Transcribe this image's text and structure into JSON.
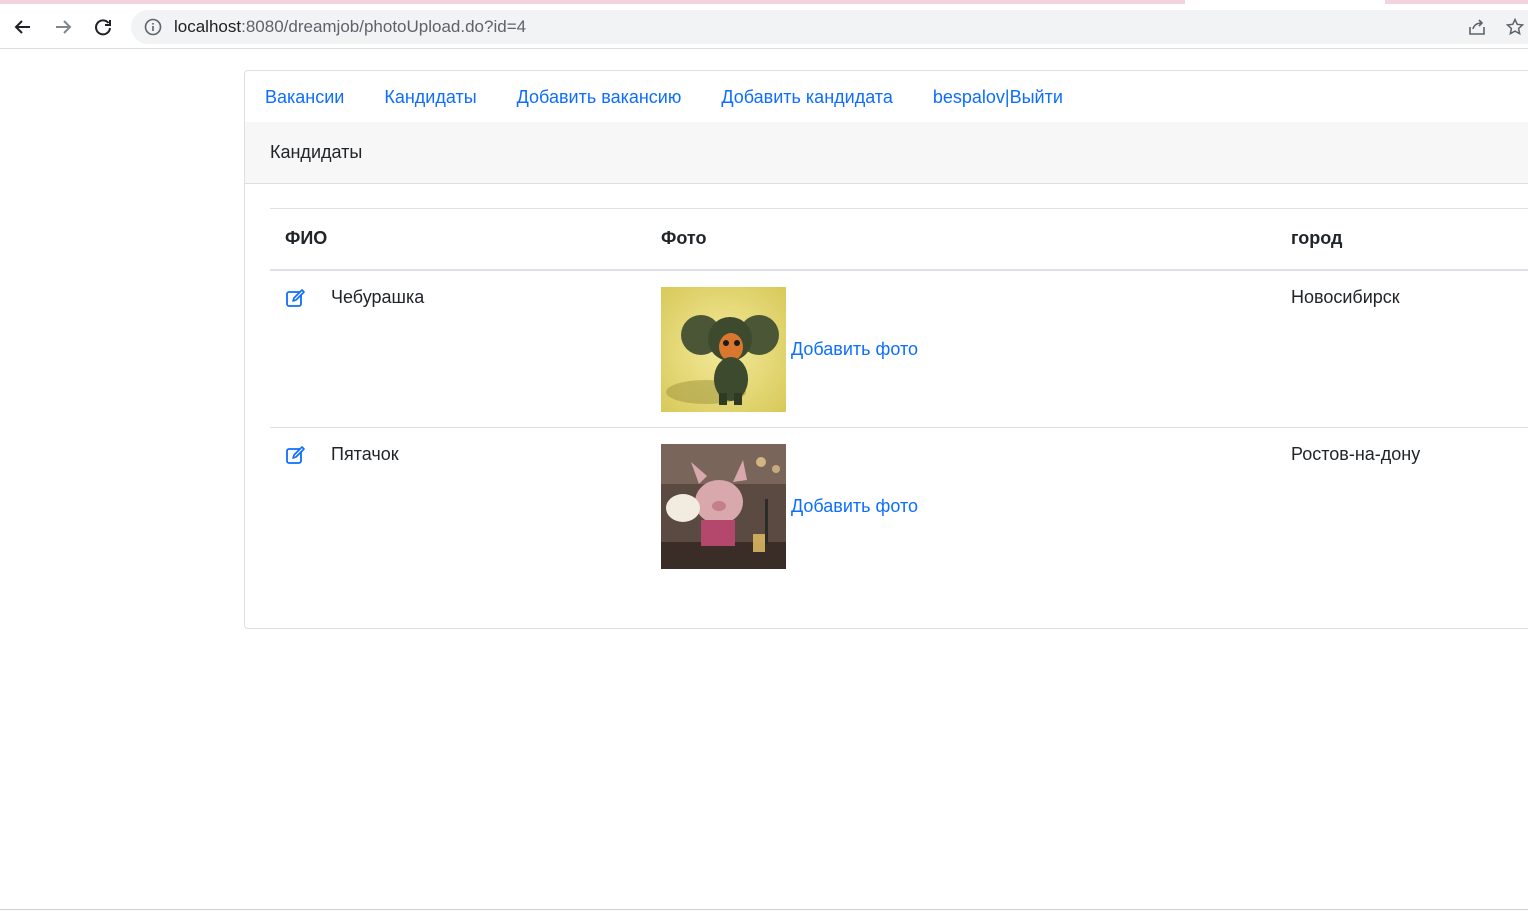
{
  "browser": {
    "url_host": "localhost",
    "url_rest": ":8080/dreamjob/photoUpload.do?id=4"
  },
  "nav": {
    "vacancies": "Вакансии",
    "candidates": "Кандидаты",
    "add_vacancy": "Добавить вакансию",
    "add_candidate": "Добавить кандидата",
    "user_logout": "bespalov|Выйти"
  },
  "header": {
    "title": "Кандидаты"
  },
  "table": {
    "columns": [
      "ФИО",
      "Фото",
      "город"
    ],
    "rows": [
      {
        "name": "Чебурашка",
        "photo_link": "Добавить фото",
        "city": "Новосибирск"
      },
      {
        "name": "Пятачок",
        "photo_link": "Добавить фото",
        "city": "Ростов-на-дону"
      }
    ]
  },
  "colors": {
    "link": "#0d6efd",
    "header_bg": "#f7f7f7"
  }
}
